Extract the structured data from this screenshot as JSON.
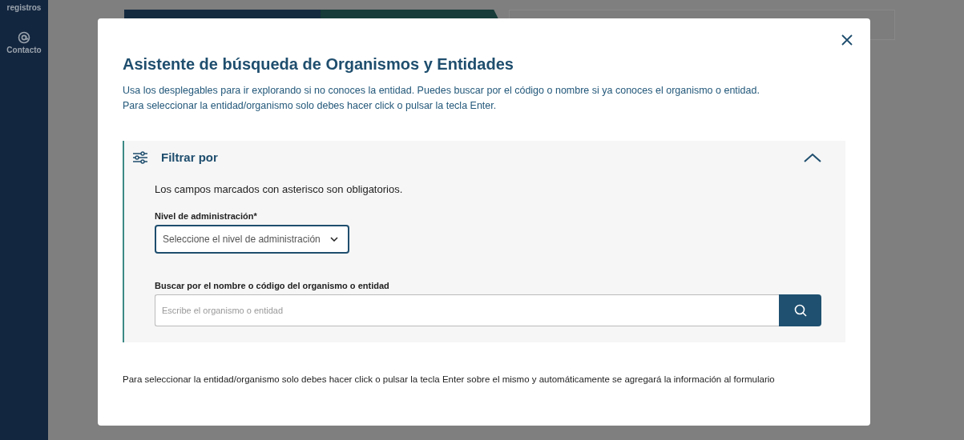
{
  "sidebar": {
    "items": [
      {
        "label": "registros",
        "kind": "text"
      },
      {
        "label": "Contacto",
        "kind": "at"
      }
    ]
  },
  "modal": {
    "title": "Asistente de búsqueda de Organismos y Entidades",
    "description_lines": [
      "Usa los desplegables para ir explorando si no conoces la entidad. Puedes buscar por el código o nombre si ya conoces el organismo o entidad.",
      "Para seleccionar la entidad/organismo solo debes hacer click o pulsar la tecla Enter."
    ],
    "filter": {
      "title": "Filtrar por",
      "expanded": true,
      "note": "Los campos marcados con asterisco son obligatorios.",
      "level_field": {
        "label": "Nivel de administración*",
        "placeholder": "Seleccione el nivel de administración"
      },
      "search_field": {
        "label": "Buscar por el nombre o código del organismo o entidad",
        "placeholder": "Escribe el organismo o entidad"
      }
    },
    "footer": "Para seleccionar la entidad/organismo solo debes hacer click o pulsar la tecla Enter sobre el mismo y automáticamente se agregará la información al formulario"
  }
}
